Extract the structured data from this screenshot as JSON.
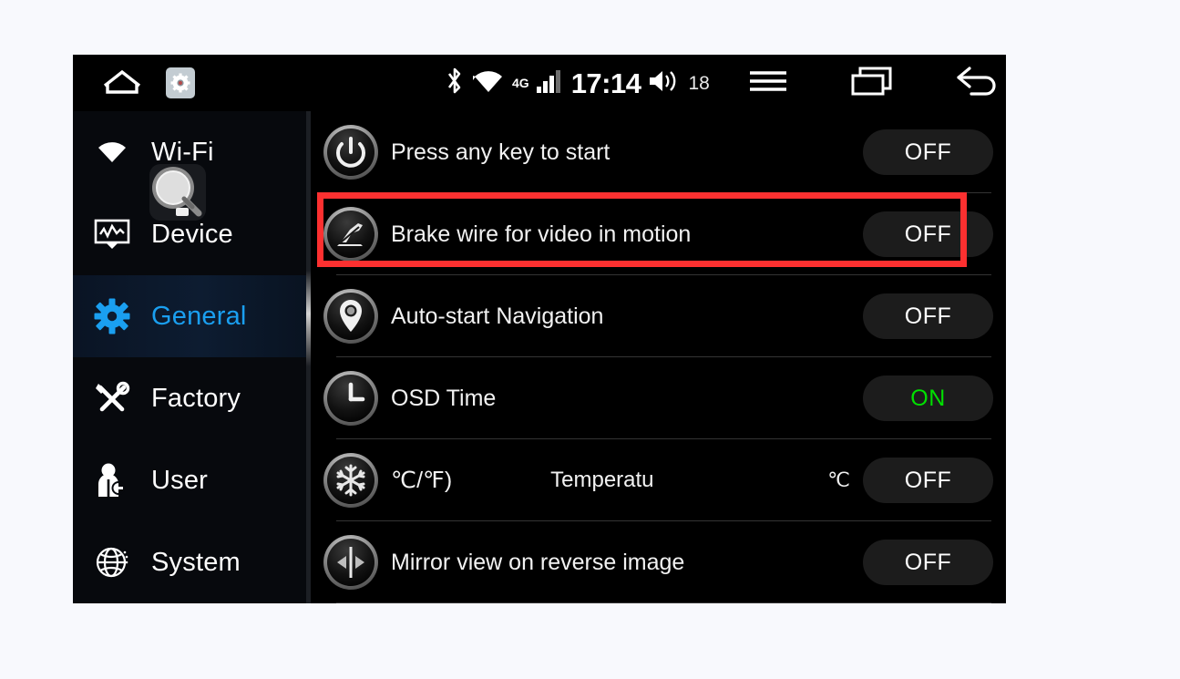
{
  "status_bar": {
    "home_icon": "home-icon",
    "settings_icon": "gear-icon",
    "bluetooth_icon": "bluetooth-icon",
    "wifi_icon": "wifi-icon",
    "network_label": "4G",
    "signal_icon": "signal-bars-icon",
    "clock": "17:14",
    "volume_icon": "volume-icon",
    "volume_level": "18",
    "menu_icon": "menu-icon",
    "recents_icon": "recent-apps-icon",
    "back_icon": "back-arrow-icon"
  },
  "sidebar": {
    "items": [
      {
        "label": "Wi-Fi",
        "icon": "wifi-settings-icon",
        "selected": false
      },
      {
        "label": "Device",
        "icon": "device-monitor-icon",
        "selected": false
      },
      {
        "label": "General",
        "icon": "gear-icon",
        "selected": true
      },
      {
        "label": "Factory",
        "icon": "tools-icon",
        "selected": false
      },
      {
        "label": "User",
        "icon": "user-icon",
        "selected": false
      },
      {
        "label": "System",
        "icon": "globe-icon",
        "selected": false
      }
    ]
  },
  "settings": {
    "rows": [
      {
        "label": "Press any key to start",
        "icon": "power-button-icon",
        "toggle": "OFF",
        "state": "off",
        "highlighted": false
      },
      {
        "label": "Brake wire for video in motion",
        "icon": "handbrake-icon",
        "toggle": "OFF",
        "state": "off",
        "highlighted": true
      },
      {
        "label": "Auto-start Navigation",
        "icon": "map-pin-icon",
        "toggle": "OFF",
        "state": "off",
        "highlighted": false
      },
      {
        "label": "OSD Time",
        "icon": "clock-icon",
        "toggle": "ON",
        "state": "on",
        "highlighted": false
      },
      {
        "label": "℃/℉)",
        "middle_label": "Temperatu",
        "unit_label": "℃",
        "icon": "snowflake-icon",
        "toggle": "OFF",
        "state": "off",
        "highlighted": false,
        "is_temperature": true
      },
      {
        "label": "Mirror view on reverse image",
        "icon": "mirror-arrows-icon",
        "toggle": "OFF",
        "state": "off",
        "highlighted": false
      }
    ]
  },
  "annotation": {
    "highlight_color": "#fc3030",
    "highlight_target": "Brake wire for video in motion"
  },
  "colors": {
    "accent_blue": "#1a9ff0",
    "on_green": "#00e000",
    "pill_bg": "#1c1c1c",
    "window_bg": "#000000",
    "page_bg": "#f8f9fd"
  },
  "cursor": {
    "icon": "magnifier-cursor-icon"
  }
}
